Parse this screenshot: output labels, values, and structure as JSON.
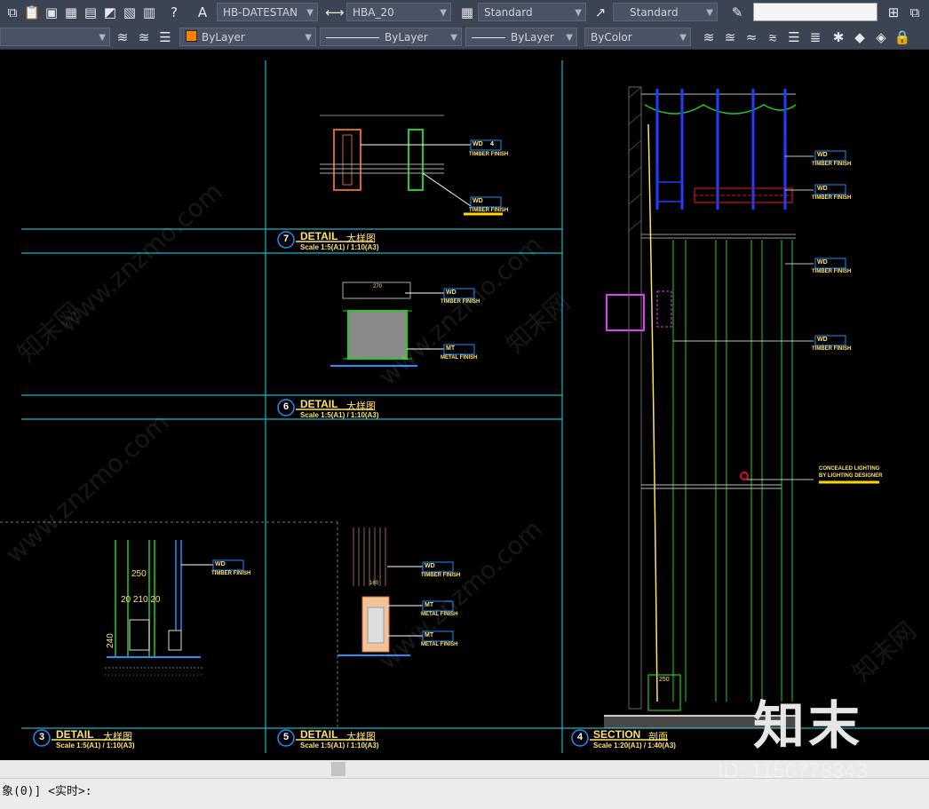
{
  "toolbar1": {
    "text_style": "HB-DATESTAN",
    "dim_style": "HBA_20",
    "table_style": "Standard",
    "multileader_style": "Standard",
    "search_value": ""
  },
  "toolbar2": {
    "color": "ByLayer",
    "color_hex": "#ff7f00",
    "linetype": "ByLayer",
    "lineweight": "ByLayer",
    "plot_style": "ByColor"
  },
  "drawing": {
    "detail7": {
      "num": "7",
      "title": "DETAIL",
      "cn": "大样图",
      "scale": "Scale 1:5(A1) / 1:10(A3)"
    },
    "detail6": {
      "num": "6",
      "title": "DETAIL",
      "cn": "大样图",
      "scale": "Scale 1:5(A1) / 1:10(A3)"
    },
    "detail3": {
      "num": "3",
      "title": "DETAIL",
      "cn": "大样图",
      "scale": "Scale 1:5(A1) / 1:10(A3)"
    },
    "detail5": {
      "num": "5",
      "title": "DETAIL",
      "cn": "大样图",
      "scale": "Scale 1:5(A1) / 1:10(A3)"
    },
    "section4": {
      "num": "4",
      "title": "SECTION",
      "cn": "剖面",
      "scale": "Scale 1:20(A1) / 1:40(A3)"
    },
    "tags": {
      "wd": "WD",
      "mt": "MT",
      "four": "4",
      "timber": "TIMBER FINISH",
      "metal": "METAL FINISH",
      "lighting1": "CONCEALED LIGHTING",
      "lighting2": "BY LIGHTING DESIGNER"
    },
    "dims": {
      "d250": "250",
      "d20_210_20": "20 210 20",
      "d240": "240",
      "d270": "270",
      "d160": "160"
    }
  },
  "watermark": {
    "site": "www.znzmo.com",
    "cn": "知末网",
    "logo": "知末",
    "id": "ID: 1156778343"
  },
  "command": {
    "text": "象(0)] <实时>:"
  }
}
